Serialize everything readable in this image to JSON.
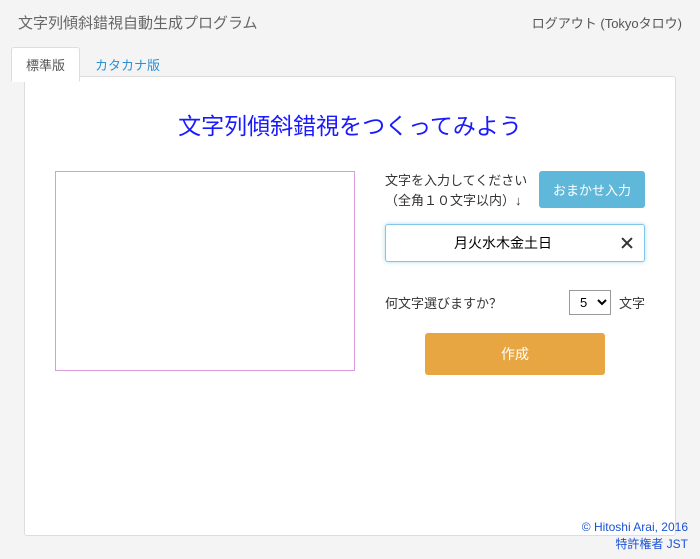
{
  "header": {
    "title": "文字列傾斜錯視自動生成プログラム",
    "logout_label": "ログアウト (Tokyoタロウ)"
  },
  "tabs": {
    "standard": "標準版",
    "katakana": "カタカナ版"
  },
  "heading": "文字列傾斜錯視をつくってみよう",
  "instructions": {
    "line1": "文字を入力してください",
    "line2": "（全角１０文字以内）↓"
  },
  "auto_button": "おまかせ入力",
  "input_value": "月火水木金土日",
  "count": {
    "question": "何文字選びますか？",
    "selected": "5",
    "unit": "文字"
  },
  "create_button": "作成",
  "footer": {
    "copyright": "© Hitoshi Arai, 2016",
    "patent": "特許権者 JST"
  }
}
